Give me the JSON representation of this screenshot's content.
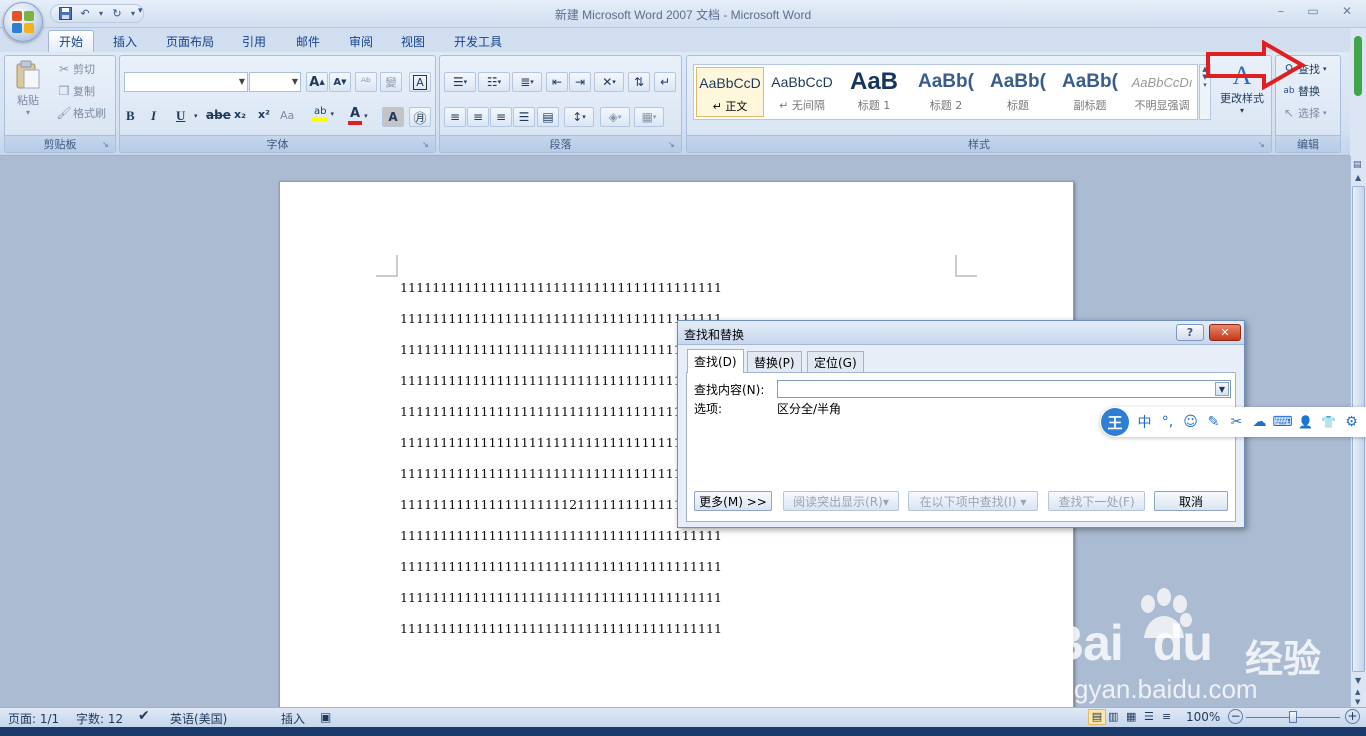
{
  "window": {
    "title": "新建 Microsoft Word 2007 文档 - Microsoft Word",
    "minimize": "–",
    "restore": "▭",
    "close": "✕"
  },
  "qat": {
    "save_icon": "save-icon",
    "undo_icon": "undo-icon",
    "redo_icon": "redo-icon",
    "customize_icon": "dropdown-icon"
  },
  "tabs": [
    "开始",
    "插入",
    "页面布局",
    "引用",
    "邮件",
    "审阅",
    "视图",
    "开发工具"
  ],
  "ribbon": {
    "clipboard": {
      "label": "剪贴板",
      "paste": "粘贴",
      "cut": "剪切",
      "copy": "复制",
      "format_painter": "格式刷"
    },
    "font": {
      "label": "字体",
      "bold": "B",
      "italic": "I",
      "underline": "U",
      "strike": "abe",
      "subscript": "x₂",
      "superscript": "x²",
      "change_case": "Aa",
      "grow": "A",
      "shrink": "A",
      "font_color": "A",
      "highlight": "ab",
      "char_shading": "A",
      "char_border": "A"
    },
    "paragraph": {
      "label": "段落"
    },
    "styles": {
      "label": "样式",
      "items": [
        {
          "sample": "AaBbCcD",
          "name": "正文"
        },
        {
          "sample": "AaBbCcD",
          "name": "无间隔"
        },
        {
          "sample": "AaB",
          "name": "标题 1"
        },
        {
          "sample": "AaBb(",
          "name": "标题 2"
        },
        {
          "sample": "AaBb(",
          "name": "标题"
        },
        {
          "sample": "AaBb(",
          "name": "副标题"
        },
        {
          "sample": "AaBbCcDı",
          "name": "不明显强调"
        }
      ],
      "change_styles": "更改样式"
    },
    "editing": {
      "label": "编辑",
      "find": "查找",
      "replace": "替换",
      "select": "选择"
    }
  },
  "document": {
    "lines": [
      "1111111111111111111111111111111111111111",
      "1111111111111111111111111111111111111111",
      "1111111111111111111111111111111111111111",
      "1111111111111111111111111111111111111111",
      "1111111111111111111111111111111111111111",
      "1111111111111111111111111111111111111111",
      "1111111111111111111111111111111111111111",
      "1111111111111111111112111111111111111111",
      "1111111111111111111111111111111111111111",
      "1111111111111111111111111111111111111111",
      "1111111111111111111111111111111111111111",
      "1111111111111111111111111111111111111111"
    ]
  },
  "dialog": {
    "title": "查找和替换",
    "help": "?",
    "close": "✕",
    "tabs": [
      "查找(D)",
      "替换(P)",
      "定位(G)"
    ],
    "find_label": "查找内容(N):",
    "find_value": "",
    "options_label": "选项:",
    "options_value": "区分全/半角",
    "more_button": "更多(M) >>",
    "reading_highlight": "阅读突出显示(R)▾",
    "find_in": "在以下项中查找(I) ▾",
    "find_next": "查找下一处(F)",
    "cancel": "取消"
  },
  "ime": {
    "logo": "王",
    "items": [
      "中",
      "°,",
      "☺",
      "✎",
      "✂",
      "☁",
      "⌨",
      "👤",
      "👕",
      "⚙"
    ]
  },
  "status": {
    "page": "页面: 1/1",
    "words": "字数: 12",
    "language": "英语(美国)",
    "mode": "插入",
    "zoom": "100%"
  },
  "watermark": {
    "brand": "Bai",
    "brand2": "du",
    "suffix": "经验",
    "url": "jingyan.baidu.com"
  },
  "colors": {
    "accent": "#15428b",
    "arrow": "#e02020",
    "ribbon": "#dbe6f4"
  }
}
